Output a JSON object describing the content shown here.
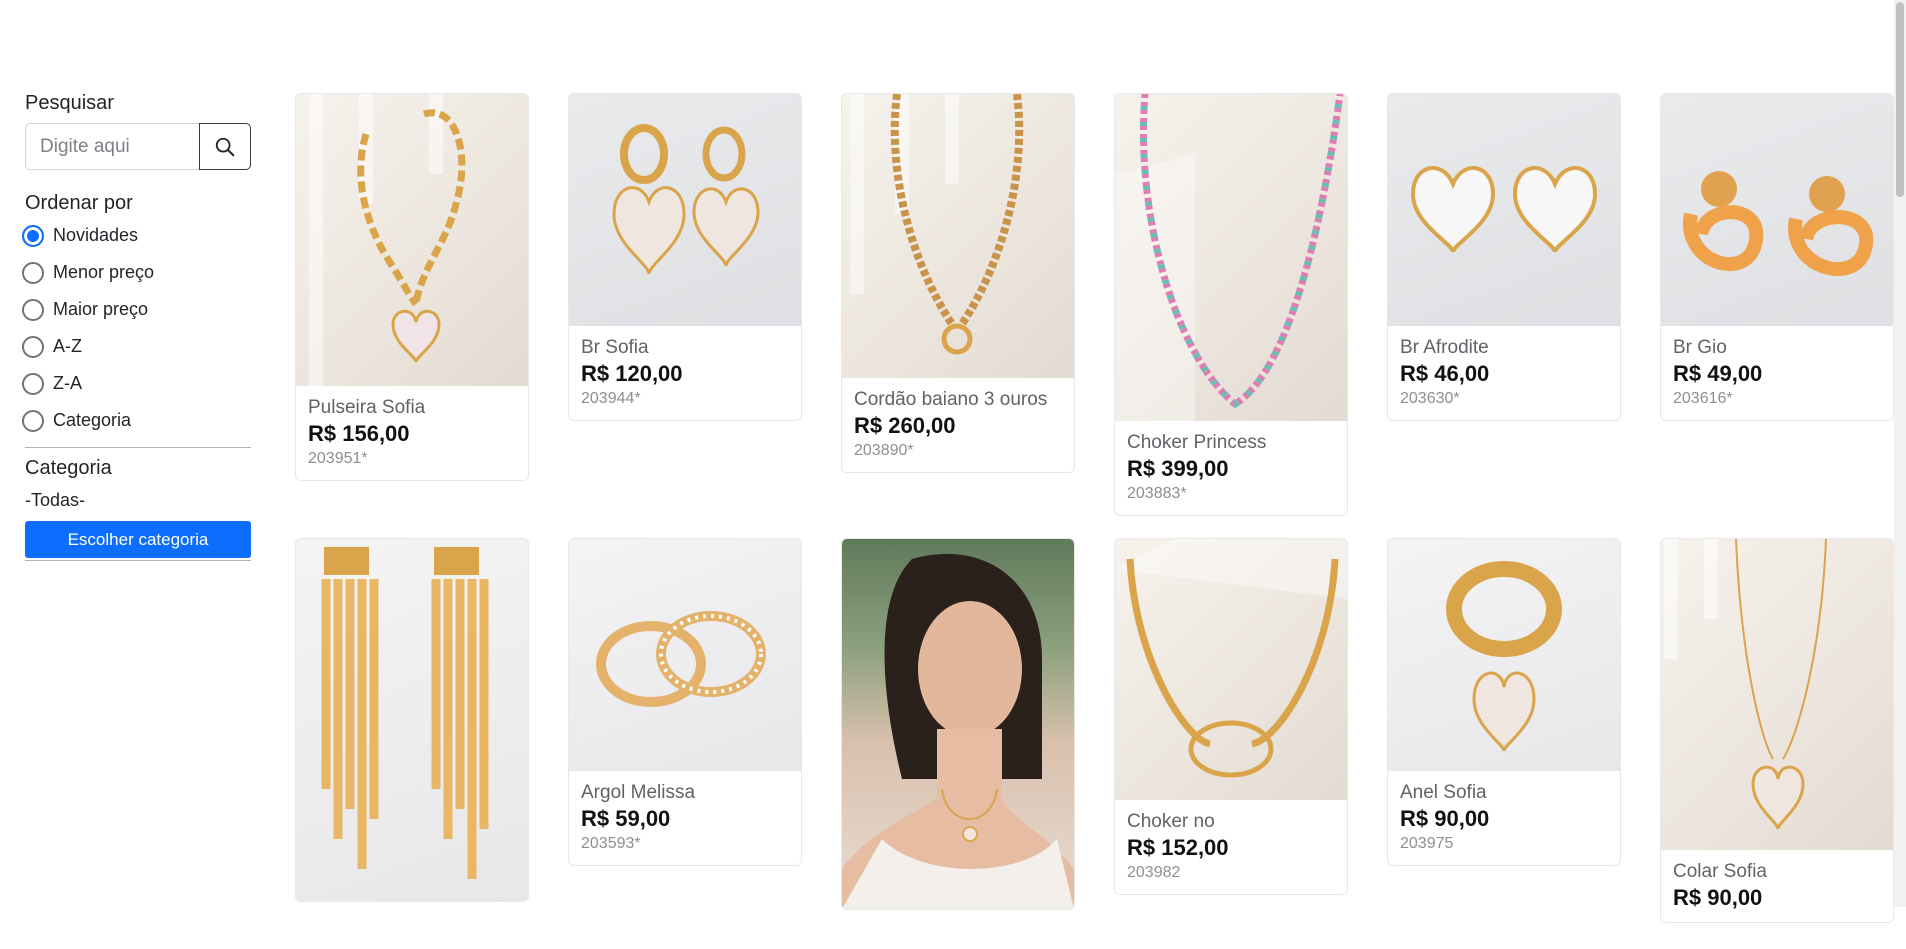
{
  "search": {
    "label": "Pesquisar",
    "placeholder": "Digite aqui",
    "value": ""
  },
  "sort": {
    "label": "Ordenar por",
    "options": [
      "Novidades",
      "Menor preço",
      "Maior preço",
      "A-Z",
      "Z-A",
      "Categoria"
    ],
    "selected": "Novidades"
  },
  "category": {
    "label": "Categoria",
    "value": "-Todas-",
    "button_label": "Escolher categoria"
  },
  "products": [
    {
      "name": "Pulseira Sofia",
      "price": "R$ 156,00",
      "code": "203951*",
      "image": "gold-chain-bracelet-heart"
    },
    {
      "name": "Br Sofia",
      "price": "R$ 120,00",
      "code": "203944*",
      "image": "heart-pave-earrings"
    },
    {
      "name": "Cordão baiano 3 ouros",
      "price": "R$ 260,00",
      "code": "203890*",
      "image": "twisted-rope-necklace"
    },
    {
      "name": "Choker Princess",
      "price": "R$ 399,00",
      "code": "203883*",
      "image": "multicolor-tennis-choker"
    },
    {
      "name": "Br Afrodite",
      "price": "R$ 46,00",
      "code": "203630*",
      "image": "crystal-heart-earrings"
    },
    {
      "name": "Br Gio",
      "price": "R$ 49,00",
      "code": "203616*",
      "image": "gold-knot-earrings"
    },
    {
      "name": "",
      "price": "",
      "code": "",
      "image": "gold-fringe-earrings"
    },
    {
      "name": "Argol Melissa",
      "price": "R$ 59,00",
      "code": "203593*",
      "image": "pave-hoop-earrings"
    },
    {
      "name": "",
      "price": "",
      "code": "",
      "image": "model-wearing-necklace"
    },
    {
      "name": "Choker no",
      "price": "R$ 152,00",
      "code": "203982",
      "image": "snake-chain-choker"
    },
    {
      "name": "Anel Sofia",
      "price": "R$ 90,00",
      "code": "203975",
      "image": "gold-ring-heart"
    },
    {
      "name": "Colar Sofia",
      "price": "R$ 90,00",
      "code": "",
      "image": "heart-pendant-necklace"
    }
  ],
  "colors": {
    "primary": "#0d6efd",
    "gold": "#d9a44a",
    "text": "#212529"
  }
}
